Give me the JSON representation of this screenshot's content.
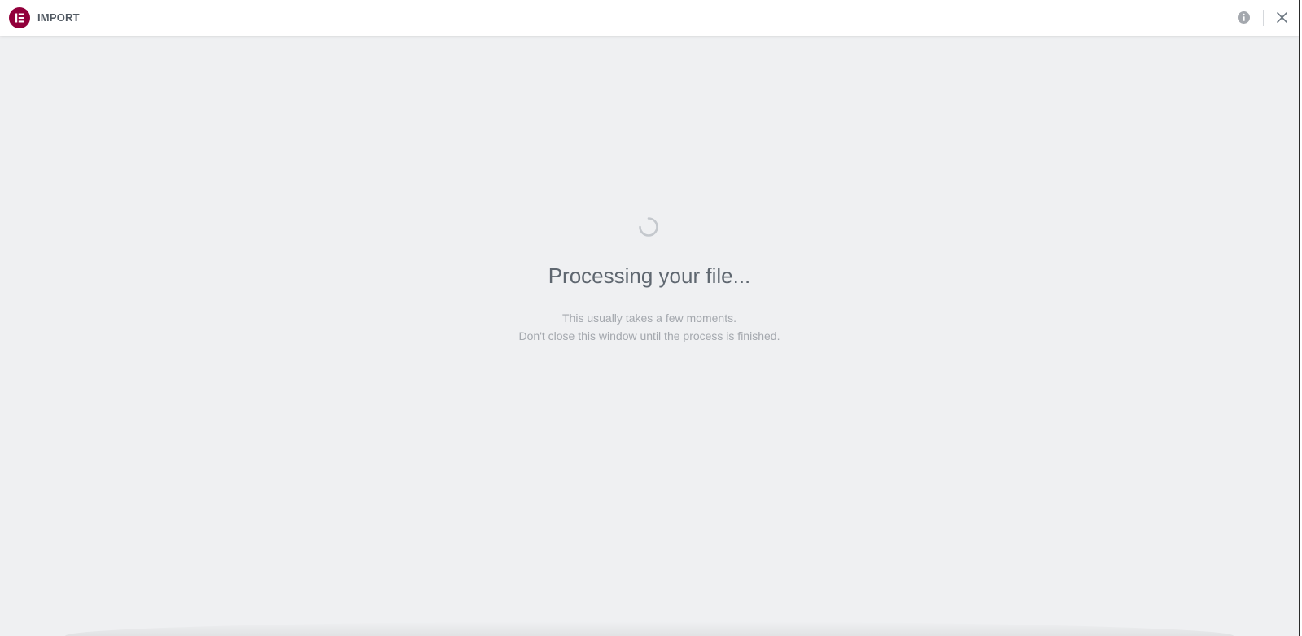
{
  "header": {
    "logo_icon": "elementor-logo-icon",
    "title": "IMPORT",
    "info_icon": "info-icon",
    "close_icon": "close-icon"
  },
  "main": {
    "spinner_icon": "loading-spinner-icon",
    "heading": "Processing your file...",
    "message_line1": "This usually takes a few moments.",
    "message_line2": "Don't close this window until the process is finished."
  },
  "colors": {
    "brand": "#92003b",
    "background": "#eff0f2",
    "heading_text": "#5f6770",
    "muted_text": "#a4a8ae"
  }
}
